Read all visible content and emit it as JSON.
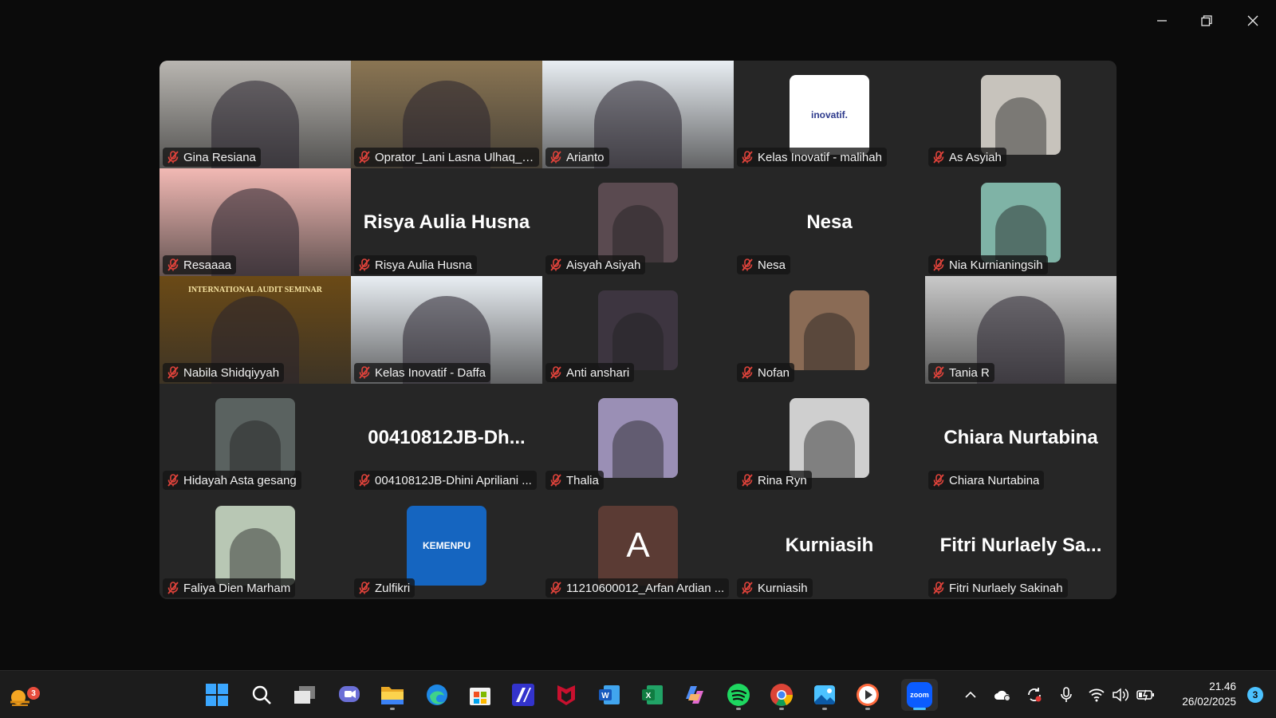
{
  "participants": [
    {
      "name": "Gina Resiana",
      "kind": "video",
      "bg": "#b9b6b1"
    },
    {
      "name": "Oprator_Lani Lasna Ulhaq_Himi...",
      "kind": "video",
      "bg": "#8a7553",
      "active": true
    },
    {
      "name": "Arianto",
      "kind": "video",
      "bg": "#e9eef3"
    },
    {
      "name": "Kelas Inovatif - malihah",
      "kind": "avatar",
      "bg": "#ffffff",
      "avatar_text": "inovatif."
    },
    {
      "name": "As Asyiah",
      "kind": "avatar",
      "bg": "#c7c3bc"
    },
    {
      "name": "Resaaaa",
      "kind": "video",
      "bg": "#f2b9b4"
    },
    {
      "name": "Risya Aulia Husna",
      "kind": "text",
      "big": "Risya Aulia Husna"
    },
    {
      "name": "Aisyah Asiyah",
      "kind": "avatar",
      "bg": "#5a4a50"
    },
    {
      "name": "Nesa",
      "kind": "text",
      "big": "Nesa"
    },
    {
      "name": "Nia Kurnianingsih",
      "kind": "avatar",
      "bg": "#7fb3a6"
    },
    {
      "name": "Nabila Shidqiyyah",
      "kind": "video",
      "bg": "#6b4a16",
      "banner": "INTERNATIONAL AUDIT SEMINAR"
    },
    {
      "name": "Kelas Inovatif - Daffa",
      "kind": "video",
      "bg": "#e9eef3"
    },
    {
      "name": "Anti anshari",
      "kind": "avatar",
      "bg": "#3d3540"
    },
    {
      "name": "Nofan",
      "kind": "avatar",
      "bg": "#8a6b55"
    },
    {
      "name": "Tania R",
      "kind": "video",
      "bg": "#c9c9c9"
    },
    {
      "name": "Hidayah Asta gesang",
      "kind": "avatar",
      "bg": "#5a6260"
    },
    {
      "name": "00410812JB-Dhini Apriliani ...",
      "kind": "text",
      "big": "00410812JB-Dh..."
    },
    {
      "name": "Thalia",
      "kind": "avatar",
      "bg": "#9a8fb5"
    },
    {
      "name": "Rina Ryn",
      "kind": "avatar",
      "bg": "#cfcfcf"
    },
    {
      "name": "Chiara Nurtabina",
      "kind": "text",
      "big": "Chiara Nurtabina"
    },
    {
      "name": "Faliya Dien Marham",
      "kind": "avatar",
      "bg": "#b8c7b4"
    },
    {
      "name": "Zulfikri",
      "kind": "avatar",
      "bg": "#1565c0",
      "avatar_text": "KEMENPU"
    },
    {
      "name": "11210600012_Arfan Ardian ...",
      "kind": "letter",
      "bg": "#5b3b34",
      "letter": "A"
    },
    {
      "name": "Kurniasih",
      "kind": "text",
      "big": "Kurniasih"
    },
    {
      "name": "Fitri Nurlaely Sakinah",
      "kind": "text",
      "big": "Fitri  Nurlaely Sa..."
    }
  ],
  "taskbar": {
    "weather_badge": "3",
    "apps": [
      "start-icon",
      "search-icon",
      "task-view-icon",
      "chat-icon",
      "file-explorer-icon",
      "edge-icon",
      "store-icon",
      "shortcut-icon",
      "mcafee-icon",
      "word-icon",
      "excel-icon",
      "m365-icon",
      "spotify-icon",
      "chrome-icon",
      "photos-icon",
      "media-player-icon",
      "zoom-icon"
    ],
    "zoom_label": "zoom",
    "time": "21.46",
    "date": "26/02/2025",
    "notifications": "3"
  }
}
